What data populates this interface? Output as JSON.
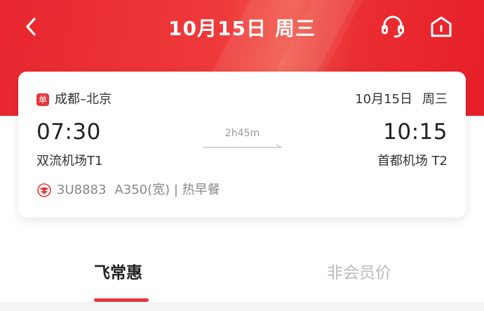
{
  "header": {
    "title_date": "10月15日",
    "title_weekday": "周三",
    "icons": {
      "back": "chevron-left-icon",
      "service": "headset-icon",
      "home": "home-icon"
    },
    "colors": {
      "primary": "#e8262f",
      "accent": "#e8353a"
    }
  },
  "flight": {
    "trip_badge": "单",
    "route": "成都–北京",
    "date": "10月15日",
    "weekday": "周三",
    "departure_time": "07:30",
    "arrival_time": "10:15",
    "duration": "2h45m",
    "departure_airport": "双流机场T1",
    "arrival_airport": "首都机场 T2",
    "flight_number": "3U8883",
    "aircraft": "A350(宽)",
    "meal": "| 热早餐"
  },
  "tabs": [
    {
      "label": "飞常惠",
      "active": true
    },
    {
      "label": "非会员价",
      "active": false
    }
  ]
}
